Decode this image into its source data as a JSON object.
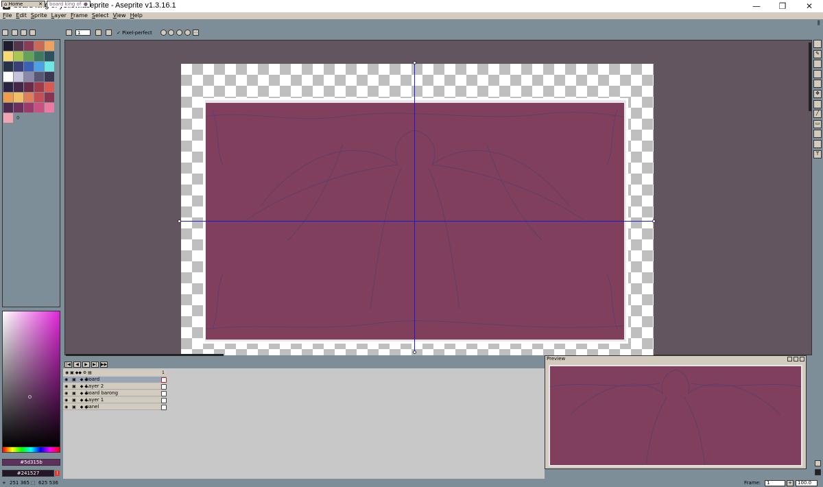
{
  "window": {
    "title": "board king of yellow.aseprite - Aseprite v1.3.16.1",
    "minimize": "—",
    "maximize": "❐",
    "close": "✕"
  },
  "menu": [
    "File",
    "Edit",
    "Sprite",
    "Layer",
    "Frame",
    "Select",
    "View",
    "Help"
  ],
  "tabs": [
    {
      "label": "Home"
    },
    {
      "label": "board king of"
    }
  ],
  "toolbar": {
    "brush_size": "1",
    "pixel_perfect_label": "Pixel-perfect"
  },
  "palette": {
    "swatches": [
      "#1e1c2e",
      "#55344e",
      "#8b3c54",
      "#c86a55",
      "#eea25f",
      "#f6d96f",
      "#a8c84f",
      "#63a356",
      "#3d7a5e",
      "#2e5160",
      "#273248",
      "#3a3f78",
      "#3c5fb7",
      "#4f9fe4",
      "#6ee8e2",
      "#ffffff",
      "#c5c2d9",
      "#8a87a8",
      "#5a5675",
      "#3b3652",
      "#2b2440",
      "#44284a",
      "#6a2b47",
      "#a03b4a",
      "#d85a52",
      "#f19c4a",
      "#f3bf64",
      "#e27c5a",
      "#c45057",
      "#8a3452",
      "#4a2a4e",
      "#6e2f5c",
      "#9b3a6b",
      "#c9517f",
      "#eb7aa1",
      "#f2a3b0"
    ],
    "page_label": "0"
  },
  "colors": {
    "fg_hex": "#5d315b",
    "bg_hex": "#241527",
    "fg": "#5d315b",
    "bg": "#241527"
  },
  "timeline": {
    "frame_header": "1",
    "layers": [
      {
        "name": "board",
        "selected": true
      },
      {
        "name": "Layer 2",
        "selected": false
      },
      {
        "name": "board barong",
        "selected": false
      },
      {
        "name": "Layer 1",
        "selected": false
      },
      {
        "name": "panel",
        "selected": false
      }
    ]
  },
  "preview": {
    "title": "Preview"
  },
  "status": {
    "cursor": "251 365",
    "size": "625 536",
    "frame_label": "Frame:",
    "frame_value": "1",
    "zoom": "100.0"
  }
}
